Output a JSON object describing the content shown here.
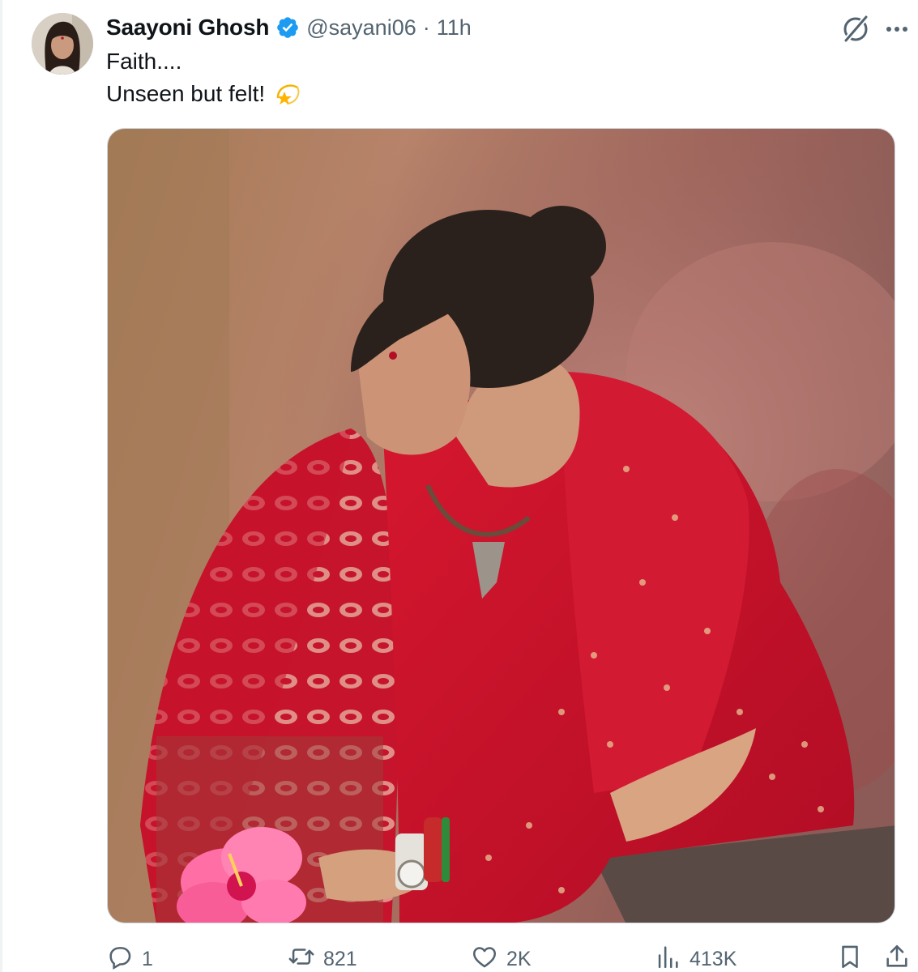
{
  "tweet": {
    "author": {
      "display_name": "Saayoni Ghosh",
      "handle": "@sayani06",
      "verified": true
    },
    "separator": "·",
    "time": "11h",
    "text_lines": [
      "Faith....",
      "Unseen but felt!"
    ],
    "emoji": "dizzy-star-emoji",
    "media": {
      "description": "photo",
      "colors": {
        "saree": "#c8102e",
        "backdrop": "#a86f5e",
        "flower": "#ff6fa6"
      }
    }
  },
  "actions": {
    "reply_count": "1",
    "retweet_count": "821",
    "like_count": "2K",
    "view_count": "413K"
  },
  "icons": {
    "reply": "reply-icon",
    "retweet": "retweet-icon",
    "like": "heart-icon",
    "views": "views-icon",
    "bookmark": "bookmark-icon",
    "share": "share-icon",
    "grok": "grok-icon",
    "more": "more-icon"
  },
  "colors": {
    "text_primary": "#0f1419",
    "text_secondary": "#536471",
    "verified_blue": "#1d9bf0",
    "border": "#cfd9de"
  }
}
